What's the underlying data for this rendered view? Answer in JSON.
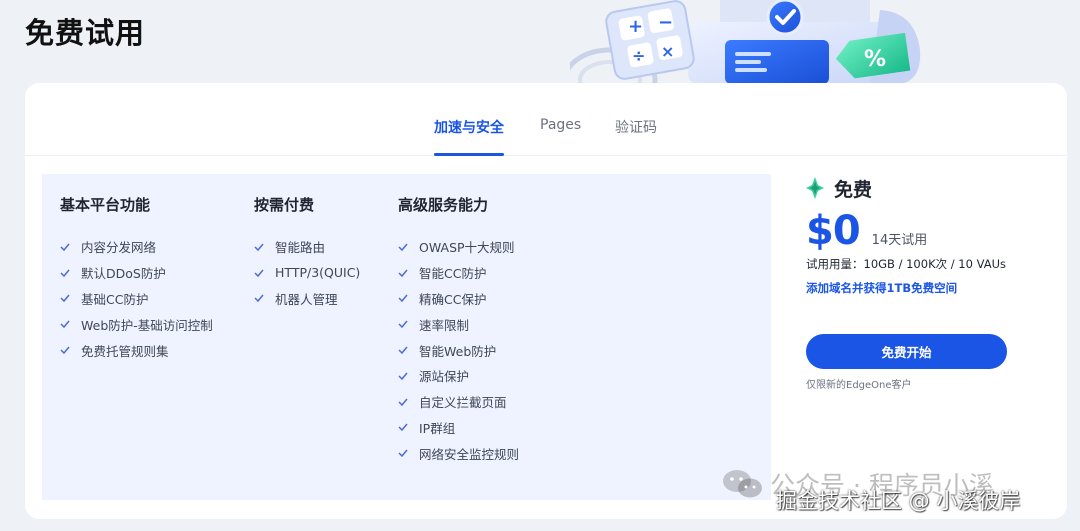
{
  "page": {
    "title": "免费试用"
  },
  "tabs": [
    {
      "label": "加速与安全",
      "active": true
    },
    {
      "label": "Pages",
      "active": false
    },
    {
      "label": "验证码",
      "active": false
    }
  ],
  "features": {
    "columns": [
      {
        "title": "基本平台功能",
        "items": [
          "内容分发网络",
          "默认DDoS防护",
          "基础CC防护",
          "Web防护-基础访问控制",
          "免费托管规则集"
        ]
      },
      {
        "title": "按需付费",
        "items": [
          "智能路由",
          "HTTP/3(QUIC)",
          "机器人管理"
        ]
      },
      {
        "title": "高级服务能力",
        "items": [
          "OWASP十大规则",
          "智能CC防护",
          "精确CC保护",
          "速率限制",
          "智能Web防护",
          "源站保护",
          "自定义拦截页面",
          "IP群组",
          "网络安全监控规则"
        ]
      }
    ]
  },
  "plan": {
    "name": "免费",
    "price": "$0",
    "trial_note": "14天试用",
    "usage": "试用用量：10GB / 100K次 / 10 VAUs",
    "promo_link": "添加域名并获得1TB免费空间",
    "cta_label": "免费开始",
    "restriction": "仅限新的EdgeOne客户"
  },
  "hero": {
    "percent_symbol": "%"
  },
  "watermarks": {
    "wechat": "公众号 · 程序员小溪",
    "juejin": "掘金技术社区 @ 小溪彼岸"
  },
  "colors": {
    "accent": "#1a55e6",
    "feature_bg": "#eef3ff",
    "page_bg": "#eef1f6",
    "badge_green": "#34d399"
  }
}
